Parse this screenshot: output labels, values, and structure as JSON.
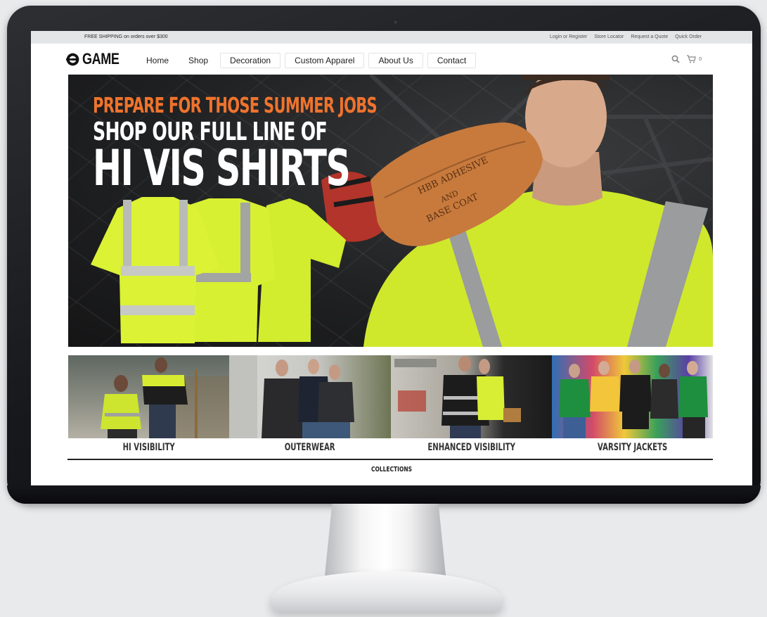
{
  "topbar": {
    "shipping_text": "FREE SHIPPING on orders over $300",
    "links": [
      "Login or Register",
      "Store Locator",
      "Request a Quote",
      "Quick Order"
    ]
  },
  "brand": {
    "name": "GAME"
  },
  "nav": {
    "items": [
      "Home",
      "Shop",
      "Decoration",
      "Custom Apparel",
      "About Us",
      "Contact"
    ],
    "cart_count": "0"
  },
  "hero": {
    "line1": "PREPARE FOR THOSE SUMMER JOBS",
    "line2": "SHOP OUR FULL LINE OF",
    "line3": "HI VIS SHIRTS",
    "bag_text": [
      "HBB ADHESIVE",
      "AND",
      "BASE COAT"
    ]
  },
  "categories": [
    "HI VISIBILITY",
    "OUTERWEAR",
    "ENHANCED VISIBILITY",
    "VARSITY JACKETS"
  ],
  "footer": {
    "collections_label": "COLLECTIONS"
  },
  "colors": {
    "hivis": "#d4ee2b",
    "accent_orange": "#f0732c",
    "reflective": "#9a9c9e"
  }
}
